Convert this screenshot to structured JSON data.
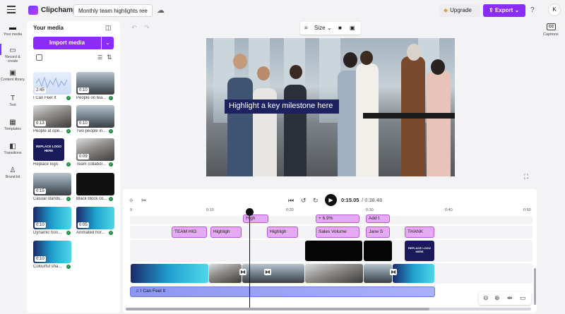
{
  "app": {
    "name": "Clipchamp",
    "project_title": "Monthly team highlights ree"
  },
  "header": {
    "upgrade_label": "Upgrade",
    "export_label": "Export",
    "help_label": "?",
    "avatar_initial": "K"
  },
  "rail": [
    {
      "label": "Your media",
      "icon": "folder-icon"
    },
    {
      "label": "Record & create",
      "icon": "camera-icon"
    },
    {
      "label": "Content library",
      "icon": "library-icon"
    },
    {
      "label": "Text",
      "icon": "text-icon"
    },
    {
      "label": "Templates",
      "icon": "templates-icon"
    },
    {
      "label": "Transitions",
      "icon": "transitions-icon"
    },
    {
      "label": "Brand kit",
      "icon": "brand-kit-icon"
    }
  ],
  "media": {
    "title": "Your media",
    "import_label": "Import media",
    "items": [
      {
        "label": "I Can Feel It",
        "duration": "2:45",
        "type": "audio"
      },
      {
        "label": "People on tea...",
        "duration": "0:10",
        "type": "video"
      },
      {
        "label": "People at ope...",
        "duration": "0:13",
        "type": "video"
      },
      {
        "label": "Two people in...",
        "duration": "0:10",
        "type": "video"
      },
      {
        "label": "Replace logo",
        "duration": "",
        "type": "image",
        "thumb_text": "REPLACE LOGO HERE"
      },
      {
        "label": "Team collabor...",
        "duration": "0:09",
        "type": "video"
      },
      {
        "label": "Casual standu...",
        "duration": "0:15",
        "type": "video"
      },
      {
        "label": "Black block co...",
        "duration": "",
        "type": "color"
      },
      {
        "label": "Dynamic hori...",
        "duration": "0:10",
        "type": "graphic"
      },
      {
        "label": "Animated hor...",
        "duration": "0:05",
        "type": "graphic"
      },
      {
        "label": "Colourful sha...",
        "duration": "0:10",
        "type": "graphic"
      }
    ]
  },
  "preview": {
    "size_label": "Size",
    "caption": "Highlight a key milestone here"
  },
  "right_rail": {
    "captions_icon_text": "CC",
    "captions_label": "Captions"
  },
  "timeline": {
    "current_time": "0:15.05",
    "separator": "/",
    "total_time": "0:38.48",
    "ticks": [
      "0",
      "0:10",
      "0:20",
      "0:30",
      "0:40",
      "0:50"
    ],
    "text_clips_row1": [
      "High",
      "+ 6.9%",
      "Add t"
    ],
    "text_clips_row2": [
      "TEAM HIG",
      "Highligh",
      "Highligh",
      "Sales Volume",
      "Jane S",
      "THANK"
    ],
    "logo_clip_text": "REPLACE LOGO HERE",
    "audio_label": "I Can Feel It"
  },
  "colors": {
    "accent": "#8a2cf6",
    "text_clip": "#e5a9f5",
    "audio_clip": "#8d97f0",
    "caption_bg": "#1d2160"
  }
}
